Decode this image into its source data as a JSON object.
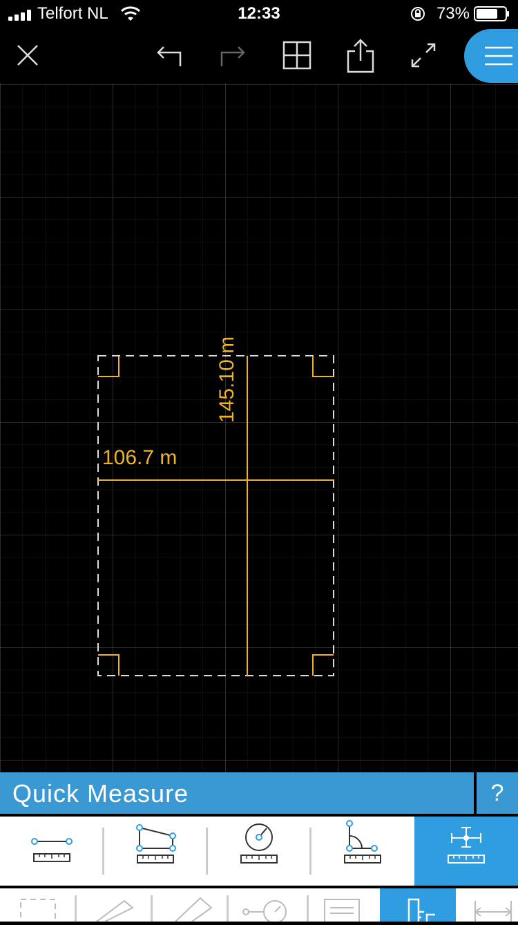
{
  "status_bar": {
    "carrier": "Telfort NL",
    "time": "12:33",
    "battery": "73%"
  },
  "toolbar": {
    "close_icon": "close-icon",
    "undo_icon": "undo-icon",
    "redo_icon": "redo-icon",
    "grid_icon": "grid-view-icon",
    "share_icon": "share-icon",
    "fullscreen_icon": "expand-icon",
    "menu_icon": "hamburger-menu-icon"
  },
  "drawing": {
    "width_label": "106.7 m",
    "height_label": "145.10 m",
    "accent_color": "#f0b323"
  },
  "panel": {
    "title": "Quick Measure",
    "help": "?",
    "accent_color": "#3a98d2",
    "tools": [
      {
        "name": "linear-measure",
        "active": false
      },
      {
        "name": "angled-measure",
        "active": false
      },
      {
        "name": "radius-measure",
        "active": false
      },
      {
        "name": "angle-measure",
        "active": false
      },
      {
        "name": "quick-measure",
        "active": true
      }
    ],
    "secondary_tools": [
      {
        "name": "rectangle-select",
        "active": false
      },
      {
        "name": "pencil",
        "active": false
      },
      {
        "name": "eraser",
        "active": false
      },
      {
        "name": "circle-tool",
        "active": false
      },
      {
        "name": "text-box",
        "active": false
      },
      {
        "name": "layout-tool",
        "active": true
      },
      {
        "name": "dimension-tool",
        "active": false
      }
    ]
  }
}
